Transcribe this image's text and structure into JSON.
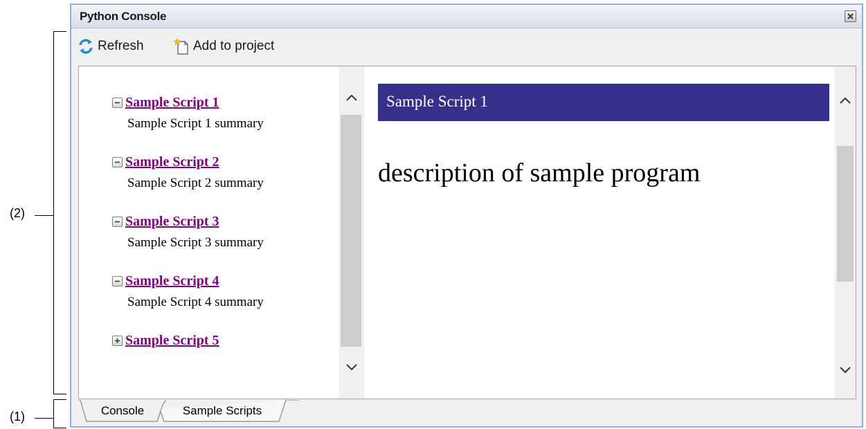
{
  "callouts": [
    {
      "label": "(2)"
    },
    {
      "label": "(1)"
    }
  ],
  "window": {
    "title": "Python Console"
  },
  "toolbar": {
    "refresh_label": "Refresh",
    "add_label": "Add to project"
  },
  "scripts": [
    {
      "title": "Sample Script 1",
      "summary": "Sample Script 1 summary",
      "expanded": true
    },
    {
      "title": "Sample Script 2",
      "summary": "Sample Script 2 summary",
      "expanded": true
    },
    {
      "title": "Sample Script 3",
      "summary": "Sample Script 3 summary",
      "expanded": true
    },
    {
      "title": "Sample Script 4",
      "summary": "Sample Script 4 summary",
      "expanded": true
    },
    {
      "title": "Sample Script 5",
      "summary": "",
      "expanded": false
    }
  ],
  "detail": {
    "header": "Sample Script 1",
    "description": "description of sample program"
  },
  "tabs": [
    {
      "label": "Console",
      "active": false
    },
    {
      "label": "Sample Scripts",
      "active": true
    }
  ],
  "colors": {
    "link": "#800080",
    "detail_header_bg": "#37308a",
    "window_border": "#8fb1d4"
  }
}
